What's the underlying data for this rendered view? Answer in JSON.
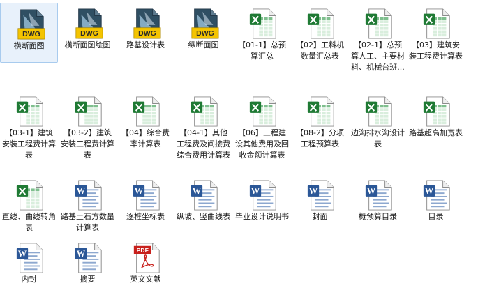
{
  "files": [
    {
      "name": "横断面图",
      "type": "dwg",
      "badge": "DWG",
      "selected": true
    },
    {
      "name": "横断面图绘图",
      "type": "dwg",
      "badge": "DWG"
    },
    {
      "name": "路基设计表",
      "type": "dwg",
      "badge": "DWG"
    },
    {
      "name": "纵断面图",
      "type": "dwg",
      "badge": "DWG"
    },
    {
      "name": "【01-1】总预算汇总",
      "type": "excel"
    },
    {
      "name": "【02】工料机数量汇总表",
      "type": "excel"
    },
    {
      "name": "【02-1】总预算人工、主要材料、机械台班...",
      "type": "excel"
    },
    {
      "name": "【03】建筑安装工程费计算表",
      "type": "excel"
    },
    {
      "name": "【03-1】建筑安装工程费计算表",
      "type": "excel"
    },
    {
      "name": "【03-2】建筑安装工程费计算表",
      "type": "excel"
    },
    {
      "name": "【04】综合费率计算表",
      "type": "excel"
    },
    {
      "name": "【04-1】其他工程费及间接费综合费用计算表",
      "type": "excel"
    },
    {
      "name": "【06】工程建设其他费用及回收金额计算表",
      "type": "excel"
    },
    {
      "name": "【08-2】分项工程预算表",
      "type": "excel"
    },
    {
      "name": "边沟排水沟设计表",
      "type": "excel"
    },
    {
      "name": "路基超高加宽表",
      "type": "excel"
    },
    {
      "name": "直线、曲线转角表",
      "type": "excel"
    },
    {
      "name": "路基土石方数量计算表",
      "type": "word"
    },
    {
      "name": "逐桩坐标表",
      "type": "word"
    },
    {
      "name": "纵坡、竖曲线表",
      "type": "word"
    },
    {
      "name": "毕业设计说明书",
      "type": "word"
    },
    {
      "name": "封面",
      "type": "word"
    },
    {
      "name": "概预算目录",
      "type": "word"
    },
    {
      "name": "目录",
      "type": "word"
    },
    {
      "name": "内封",
      "type": "word"
    },
    {
      "name": "摘要",
      "type": "word"
    },
    {
      "name": "英文文献",
      "type": "pdf",
      "badge": "PDF"
    }
  ],
  "colors": {
    "selection_bg": "#e8f1fb",
    "excel_green": "#1f7a34",
    "word_blue": "#2b5797",
    "dwg_yellow": "#f4c400",
    "pdf_red": "#c8201c"
  }
}
